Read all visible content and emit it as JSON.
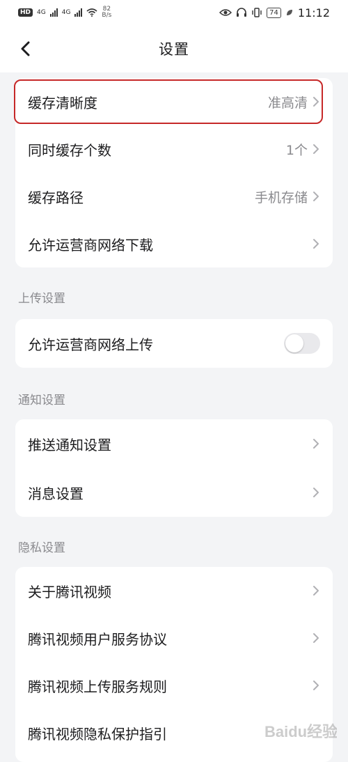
{
  "status_bar": {
    "hd_label": "HD",
    "sim1_label": "4G",
    "sim2_label": "4G",
    "speed_value": "82",
    "speed_unit": "B/s",
    "battery": "74",
    "time": "11:12"
  },
  "header": {
    "title": "设置"
  },
  "cache_settings": {
    "items": [
      {
        "label": "缓存清晰度",
        "value": "准高清"
      },
      {
        "label": "同时缓存个数",
        "value": "1个"
      },
      {
        "label": "缓存路径",
        "value": "手机存储"
      },
      {
        "label": "允许运营商网络下载",
        "value": ""
      }
    ]
  },
  "upload_settings": {
    "title": "上传设置",
    "items": [
      {
        "label": "允许运营商网络上传",
        "enabled": false
      }
    ]
  },
  "notification_settings": {
    "title": "通知设置",
    "items": [
      {
        "label": "推送通知设置"
      },
      {
        "label": "消息设置"
      }
    ]
  },
  "privacy_settings": {
    "title": "隐私设置",
    "items": [
      {
        "label": "关于腾讯视频"
      },
      {
        "label": "腾讯视频用户服务协议"
      },
      {
        "label": "腾讯视频上传服务规则"
      },
      {
        "label": "腾讯视频隐私保护指引"
      }
    ]
  },
  "watermark": {
    "text": "Baidu经验"
  },
  "colors": {
    "highlight_border": "#c62828",
    "page_background": "#f3f4f6",
    "secondary_text": "#8a8a8e"
  }
}
